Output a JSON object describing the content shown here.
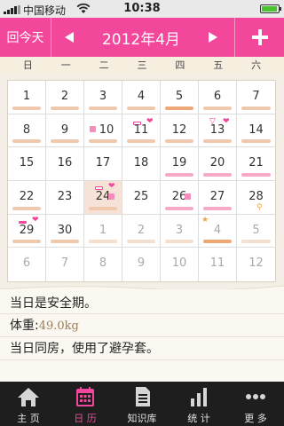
{
  "status_bar": {
    "carrier": "中国移动",
    "time": "10:38"
  },
  "header": {
    "today_button": "回今天",
    "title": "2012年4月",
    "accent_color": "#f2479a"
  },
  "weekdays": [
    "日",
    "一",
    "二",
    "三",
    "四",
    "五",
    "六"
  ],
  "calendar": {
    "rows": [
      [
        "1",
        "2",
        "3",
        "4",
        "5",
        "6",
        "7"
      ],
      [
        "8",
        "9",
        "10",
        "11",
        "12",
        "13",
        "14"
      ],
      [
        "15",
        "16",
        "17",
        "18",
        "19",
        "20",
        "21"
      ],
      [
        "22",
        "23",
        "24",
        "25",
        "26",
        "27",
        "28"
      ],
      [
        "29",
        "30",
        "1",
        "2",
        "3",
        "4",
        "5"
      ],
      [
        "6",
        "7",
        "8",
        "9",
        "10",
        "11",
        "12"
      ]
    ],
    "selected_date": "24"
  },
  "notes": {
    "safe_period": "当日是安全期。",
    "weight_label": "体重:",
    "weight_value": "49.0kg",
    "intercourse": "当日同房，使用了避孕套。"
  },
  "tabbar": {
    "items": [
      {
        "label": "主 页",
        "icon": "home-icon"
      },
      {
        "label": "日 历",
        "icon": "calendar-icon"
      },
      {
        "label": "知识库",
        "icon": "document-icon"
      },
      {
        "label": "统 计",
        "icon": "bar-chart-icon"
      },
      {
        "label": "更 多",
        "icon": "more-dots-icon"
      }
    ],
    "active": "日 历"
  }
}
